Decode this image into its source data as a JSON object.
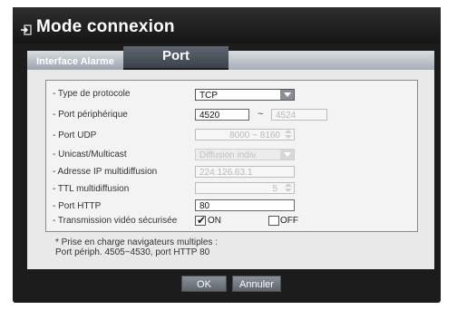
{
  "window": {
    "title": "Mode connexion"
  },
  "tabs": [
    {
      "label": "Interface Alarme",
      "active": false
    },
    {
      "label": "Port",
      "active": true
    },
    {
      "label": "",
      "active": false
    }
  ],
  "form": {
    "protocol": {
      "label": "- Type de protocole",
      "value": "TCP"
    },
    "device_port": {
      "label": "- Port périphérique",
      "from": "4520",
      "separator": "~",
      "to": "4524"
    },
    "udp_port": {
      "label": "- Port UDP",
      "value": "8000 ~ 8160"
    },
    "unicast": {
      "label": "- Unicast/Multicast",
      "value": "Diffusion indiv."
    },
    "multicast_ip": {
      "label": "- Adresse IP multidiffusion",
      "value": "224.126.63.1"
    },
    "ttl": {
      "label": "- TTL multidiffusion",
      "value": "5"
    },
    "http_port": {
      "label": "- Port HTTP",
      "value": "80"
    },
    "secure_video": {
      "label": "- Transmission vidéo sécurisée",
      "on_label": "ON",
      "off_label": "OFF",
      "on_checked": true,
      "off_checked": false
    }
  },
  "note": {
    "line1": "* Prise en charge navigateurs multiples :",
    "line2": "Port périph. 4505~4530, port HTTP 80"
  },
  "buttons": {
    "ok": "OK",
    "cancel": "Annuler"
  },
  "colors": {
    "frame": "#1c1c1c",
    "panel": "#e9e9e9",
    "active_tab": "#4a5059",
    "inactive_tab": "#b9bec6",
    "button": "#737980"
  },
  "icons": {
    "title_icon": "enter-arrow-icon",
    "dropdown_icon": "triangle-down-icon",
    "spinner_icon": "up-down-arrow-icon"
  }
}
